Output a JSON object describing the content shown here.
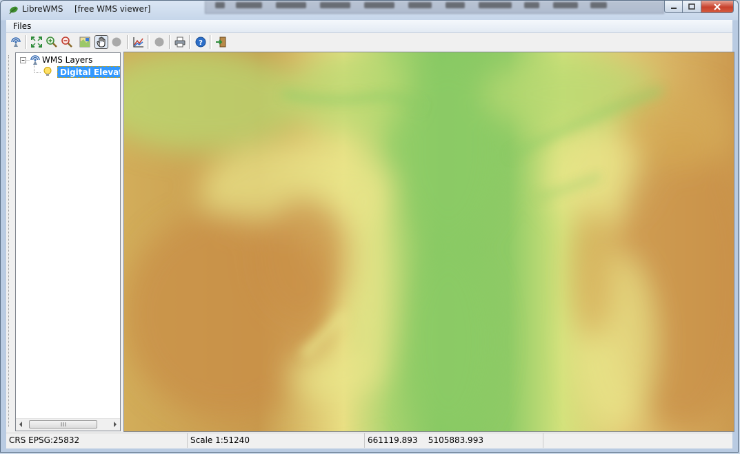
{
  "window": {
    "title": "LibreWMS",
    "subtitle": "[free WMS viewer]",
    "frame_color": "#c6d6ea",
    "close_color": "#c8412c"
  },
  "background_app_menu": [
    "File",
    "Modifica",
    "Selezione",
    "Visualizza",
    "Immagine",
    "Livello",
    "Colori",
    "Strumenti",
    "Filtri",
    "Finestre",
    "Aiuto"
  ],
  "menubar": {
    "items": [
      "Files"
    ]
  },
  "toolbar": {
    "buttons": [
      {
        "icon": "wms-connect-icon"
      },
      {
        "icon": "zoom-extent-icon"
      },
      {
        "icon": "zoom-in-icon"
      },
      {
        "icon": "zoom-out-icon"
      },
      {
        "icon": "map-identify-icon"
      },
      {
        "icon": "pan-hand-icon",
        "active": true
      },
      {
        "icon": "disabled-circle-icon"
      },
      {
        "icon": "chart-icon"
      },
      {
        "icon": "disabled-circle-icon"
      },
      {
        "icon": "print-icon"
      },
      {
        "icon": "help-icon"
      },
      {
        "icon": "exit-icon"
      }
    ]
  },
  "tree": {
    "root_label": "WMS Layers",
    "layers": [
      {
        "label": "Digital Elevation Model",
        "selected": true
      }
    ]
  },
  "map": {
    "colors": {
      "valley": "#8ccb66",
      "lowland": "#b8d872",
      "mid": "#e8e48a",
      "upland": "#d4aa55",
      "highland": "#c88f48"
    }
  },
  "statusbar": {
    "crs": "CRS EPSG:25832",
    "scale": "Scale 1:51240",
    "x": "661119.893",
    "y": "5105883.993"
  }
}
